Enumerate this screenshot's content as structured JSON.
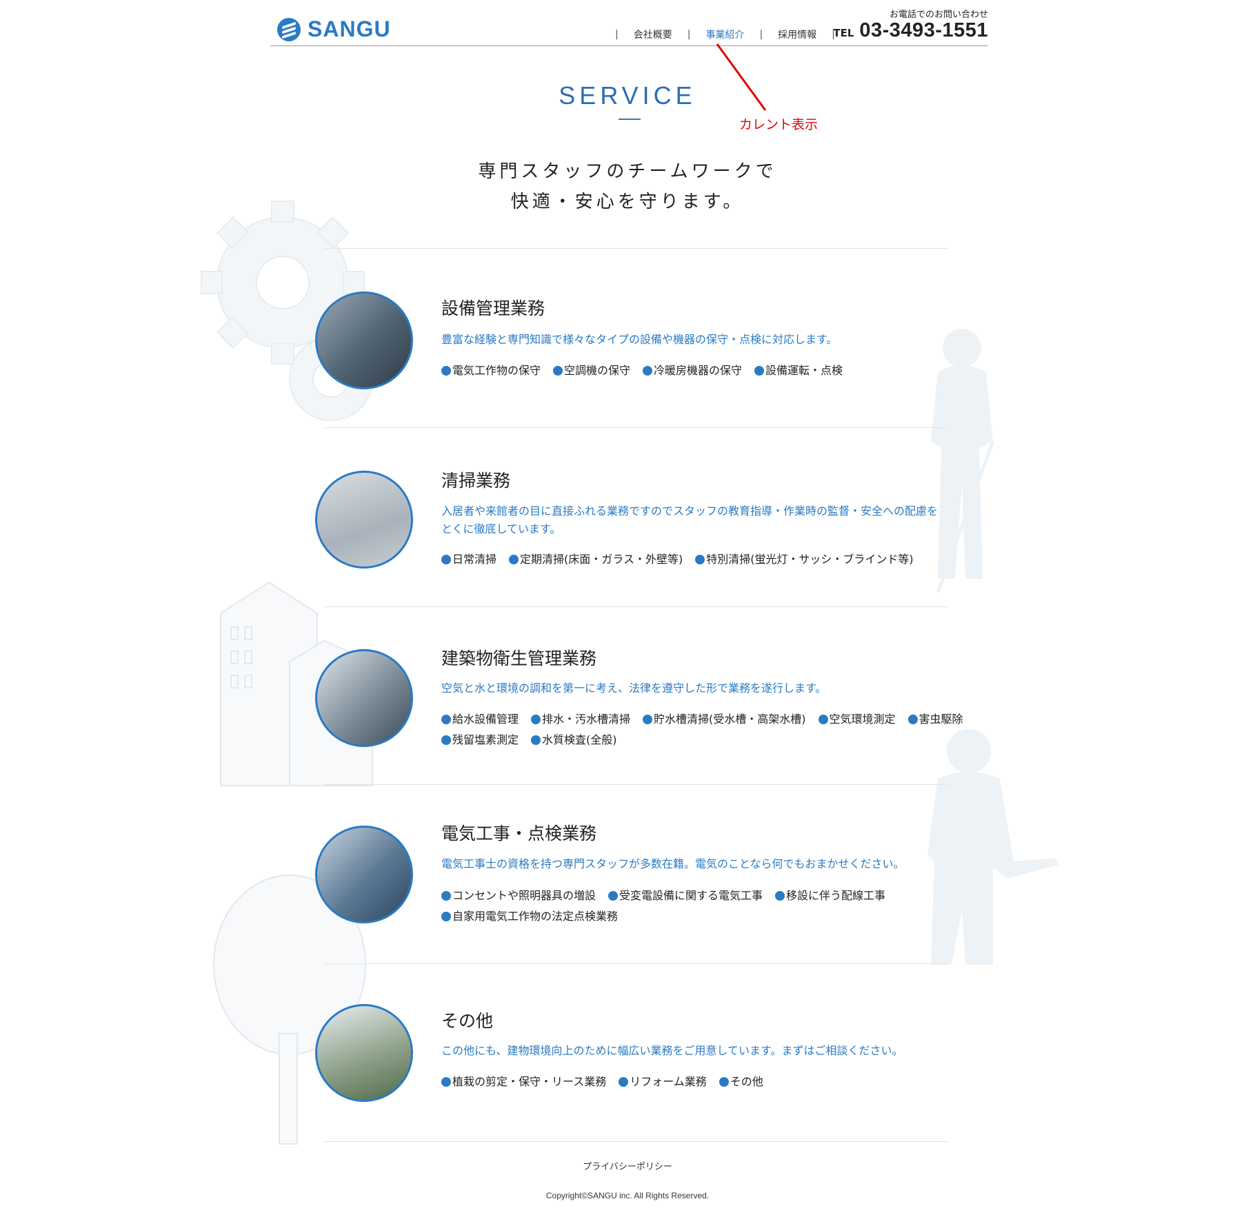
{
  "header": {
    "logo_text": "SANGU",
    "nav": [
      {
        "label": "会社概要",
        "current": false
      },
      {
        "label": "事業紹介",
        "current": true
      },
      {
        "label": "採用情報",
        "current": false
      }
    ],
    "tel_lead": "お電話でのお問い合わせ",
    "tel_prefix": "TEL",
    "tel_number": "03-3493-1551"
  },
  "annotation": {
    "label": "カレント表示",
    "color": "#e10000"
  },
  "page": {
    "title": "SERVICE",
    "lead_line1": "専門スタッフのチームワークで",
    "lead_line2": "快適・安心を守ります。"
  },
  "services": [
    {
      "title": "設備管理業務",
      "desc": "豊富な経験と専門知識で様々なタイプの設備や機器の保守・点検に対応します。",
      "tags": [
        "電気工作物の保守",
        "空調機の保守",
        "冷暖房機器の保守",
        "設備運転・点検"
      ]
    },
    {
      "title": "清掃業務",
      "desc": "入居者や来館者の目に直接ふれる業務ですのでスタッフの教育指導・作業時の監督・安全への配慮をとくに徹底しています。",
      "tags": [
        "日常清掃",
        "定期清掃(床面・ガラス・外壁等)",
        "特別清掃(蛍光灯・サッシ・ブラインド等)"
      ]
    },
    {
      "title": "建築物衛生管理業務",
      "desc": "空気と水と環境の調和を第一に考え、法律を遵守した形で業務を遂行します。",
      "tags": [
        "給水設備管理",
        "排水・汚水槽清掃",
        "貯水槽清掃(受水槽・高架水槽)",
        "空気環境測定",
        "害虫駆除",
        "残留塩素測定",
        "水質検査(全般)"
      ]
    },
    {
      "title": "電気工事・点検業務",
      "desc": "電気工事士の資格を持つ専門スタッフが多数在籍。電気のことなら何でもおまかせください。",
      "tags": [
        "コンセントや照明器具の増設",
        "受変電設備に関する電気工事",
        "移設に伴う配線工事",
        "自家用電気工作物の法定点検業務"
      ]
    },
    {
      "title": "その他",
      "desc": "この他にも、建物環境向上のために幅広い業務をご用意しています。まずはご相談ください。",
      "tags": [
        "植栽の剪定・保守・リース業務",
        "リフォーム業務",
        "その他"
      ]
    }
  ],
  "footer": {
    "privacy": "プライバシーポリシー",
    "copyright": "Copyright©SANGU inc. All Rights Reserved."
  },
  "colors": {
    "accent": "#2a7ac4",
    "annotation": "#e10000"
  }
}
